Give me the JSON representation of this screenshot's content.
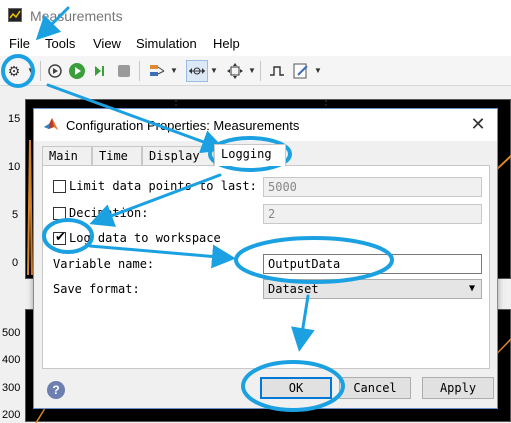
{
  "window": {
    "title": "Measurements"
  },
  "menu": {
    "items": [
      "File",
      "Tools",
      "View",
      "Simulation",
      "Help"
    ]
  },
  "toolbar": {
    "icons": [
      "gear-icon",
      "restore-icon",
      "run-icon",
      "step-forward-icon",
      "stop-icon",
      "highlight-icon",
      "zoom-x-icon",
      "fit-icon",
      "triggers-icon",
      "edit-icon"
    ]
  },
  "scope": {
    "top_plot_yticks": [
      "15",
      "10",
      "5",
      "0"
    ],
    "bottom_plot_yticks": [
      "500",
      "400",
      "300",
      "200"
    ]
  },
  "dialog": {
    "title": "Configuration Properties: Measurements",
    "close_glyph": "✕",
    "tabs": [
      "Main",
      "Time",
      "Display",
      "Logging"
    ],
    "active_tab": "Logging",
    "limit_points": {
      "label": "Limit data points to last:",
      "value": "5000",
      "checked": false
    },
    "decimation": {
      "label": "Decimation:",
      "value": "2",
      "checked": false
    },
    "log_to_workspace": {
      "label": "Log data to workspace",
      "checked": true
    },
    "variable_name": {
      "label": "Variable name:",
      "value": "OutputData"
    },
    "save_format": {
      "label": "Save format:",
      "value": "Dataset"
    },
    "help_glyph": "?",
    "ok_label": "OK",
    "cancel_label": "Cancel",
    "apply_label": "Apply"
  },
  "annotation": {
    "color": "#1ba1e2"
  }
}
